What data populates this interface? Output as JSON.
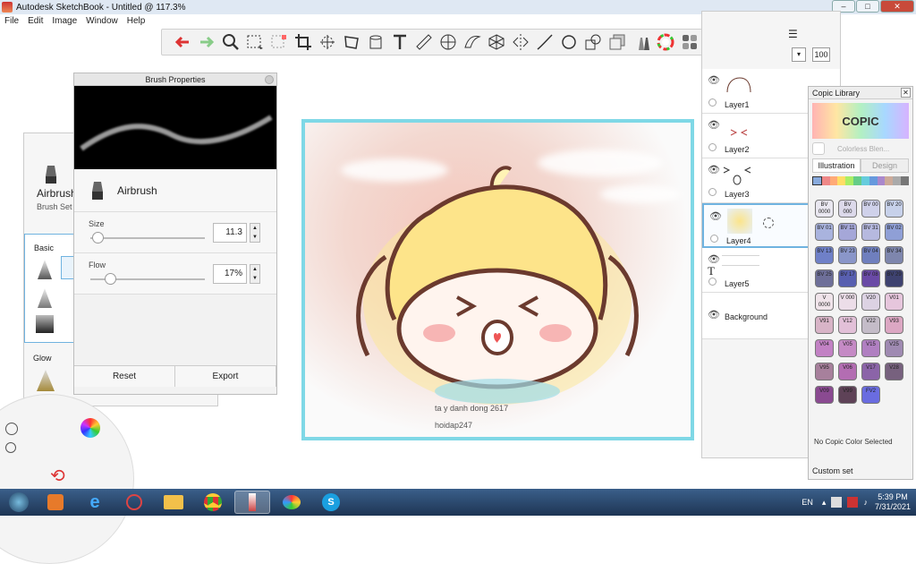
{
  "window": {
    "title": "Autodesk SketchBook - Untitled @ 117.3%"
  },
  "menu": [
    "File",
    "Edit",
    "Image",
    "Window",
    "Help"
  ],
  "toolbar": {
    "icons": [
      "undo-icon",
      "redo-icon",
      "zoom-icon",
      "select-icon",
      "lasso-icon",
      "crop-icon",
      "transform-icon",
      "distort-icon",
      "bucket-icon",
      "text-icon",
      "ruler-icon",
      "ellipse-guide-icon",
      "french-curve-icon",
      "perspective-icon",
      "symmetry-icon",
      "line-icon",
      "oval-icon",
      "shape-icon",
      "layers-icon",
      "brush-icon",
      "color-wheel-icon",
      "library-icon"
    ]
  },
  "brush_panel": {
    "name": "Airbrush",
    "set_label": "Brush Set",
    "basic_label": "Basic",
    "glow_label": "Glow"
  },
  "brush_properties": {
    "title": "Brush Properties",
    "brush_name": "Airbrush",
    "size_label": "Size",
    "size_value": "11.3",
    "size_fraction": 0.06,
    "flow_label": "Flow",
    "flow_value": "17%",
    "flow_fraction": 0.17,
    "reset_label": "Reset",
    "export_label": "Export"
  },
  "drawing": {
    "caption1": "ta y danh dong 2617",
    "caption2": "hoidap247"
  },
  "layers": {
    "opacity": "100",
    "items": [
      {
        "name": "Layer1"
      },
      {
        "name": "Layer2"
      },
      {
        "name": "Layer3"
      },
      {
        "name": "Layer4"
      },
      {
        "name": "Layer5"
      },
      {
        "name": "Background"
      }
    ]
  },
  "copic": {
    "title": "Copic Library",
    "logo": "COPIC",
    "colorless": "Colorless Blen...",
    "tab_illustration": "Illustration",
    "tab_design": "Design",
    "status": "No Copic Color Selected",
    "custom_set": "Custom set",
    "colors": [
      {
        "code": "BV 0000",
        "hex": "#e9e7f0"
      },
      {
        "code": "BV 000",
        "hex": "#dcd9ea"
      },
      {
        "code": "BV 00",
        "hex": "#cfd1ea"
      },
      {
        "code": "BV 20",
        "hex": "#c7d1ea"
      },
      {
        "code": "BV 01",
        "hex": "#a9b3de"
      },
      {
        "code": "BV 11",
        "hex": "#a5a7d8"
      },
      {
        "code": "BV 31",
        "hex": "#b6b9df"
      },
      {
        "code": "BV 02",
        "hex": "#8f9fd6"
      },
      {
        "code": "BV 13",
        "hex": "#6f80c8"
      },
      {
        "code": "BV 23",
        "hex": "#8a96c9"
      },
      {
        "code": "BV 04",
        "hex": "#6f7fbe"
      },
      {
        "code": "BV 34",
        "hex": "#7e86ad"
      },
      {
        "code": "BV 25",
        "hex": "#6e6f99"
      },
      {
        "code": "BV 17",
        "hex": "#585fb0"
      },
      {
        "code": "BV 08",
        "hex": "#6a4aa6"
      },
      {
        "code": "BV 29",
        "hex": "#3e4270"
      },
      {
        "code": "V 0000",
        "hex": "#f0e4ea"
      },
      {
        "code": "V 000",
        "hex": "#ecdde8"
      },
      {
        "code": "V20",
        "hex": "#dcd2e3"
      },
      {
        "code": "V01",
        "hex": "#e6c6dc"
      },
      {
        "code": "V91",
        "hex": "#d8b4c7"
      },
      {
        "code": "V12",
        "hex": "#e2c0d8"
      },
      {
        "code": "V22",
        "hex": "#c4bcc8"
      },
      {
        "code": "V93",
        "hex": "#dca7c3"
      },
      {
        "code": "V04",
        "hex": "#c281c4"
      },
      {
        "code": "V05",
        "hex": "#c58ac5"
      },
      {
        "code": "V15",
        "hex": "#b07fc1"
      },
      {
        "code": "V25",
        "hex": "#9f8ab2"
      },
      {
        "code": "V95",
        "hex": "#a7809c"
      },
      {
        "code": "V06",
        "hex": "#b36db2"
      },
      {
        "code": "V17",
        "hex": "#8b64a8"
      },
      {
        "code": "V28",
        "hex": "#77617e"
      },
      {
        "code": "V09",
        "hex": "#8a4a91"
      },
      {
        "code": "V99",
        "hex": "#5e4257"
      },
      {
        "code": "FV2",
        "hex": "#6a6ce0"
      }
    ]
  },
  "tray": {
    "lang": "EN",
    "time": "5:39 PM",
    "date": "7/31/2021"
  }
}
